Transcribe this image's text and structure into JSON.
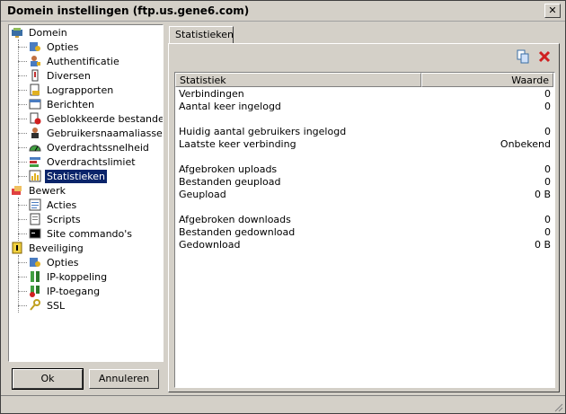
{
  "window": {
    "title": "Domein instellingen (ftp.us.gene6.com)",
    "close_glyph": "✕"
  },
  "tree": {
    "groups": [
      {
        "label": "Domein",
        "icon": "domain-icon"
      },
      {
        "label": "Bewerk",
        "icon": "edit-icon"
      },
      {
        "label": "Beveiliging",
        "icon": "security-icon"
      }
    ],
    "items": [
      {
        "label": "Opties",
        "icon": "options-icon"
      },
      {
        "label": "Authentificatie",
        "icon": "authentication-icon"
      },
      {
        "label": "Diversen",
        "icon": "misc-icon"
      },
      {
        "label": "Lograpporten",
        "icon": "logs-icon"
      },
      {
        "label": "Berichten",
        "icon": "messages-icon"
      },
      {
        "label": "Geblokkeerde bestanden",
        "icon": "blocked-files-icon"
      },
      {
        "label": "Gebruikersnaamaliassen",
        "icon": "user-aliases-icon"
      },
      {
        "label": "Overdrachtssnelheid",
        "icon": "speed-gauge-icon"
      },
      {
        "label": "Overdrachtslimiet",
        "icon": "transfer-limit-icon"
      },
      {
        "label": "Statistieken",
        "icon": "statistics-icon"
      },
      {
        "label": "Acties",
        "icon": "actions-icon"
      },
      {
        "label": "Scripts",
        "icon": "scripts-icon"
      },
      {
        "label": "Site commando's",
        "icon": "console-icon"
      },
      {
        "label": "Opties",
        "icon": "options-icon"
      },
      {
        "label": "IP-koppeling",
        "icon": "ip-binding-icon"
      },
      {
        "label": "IP-toegang",
        "icon": "ip-access-icon"
      },
      {
        "label": "SSL",
        "icon": "key-icon"
      }
    ],
    "selected": "Statistieken"
  },
  "buttons": {
    "ok": "Ok",
    "cancel": "Annuleren"
  },
  "tab": {
    "label": "Statistieken"
  },
  "toolbar": {
    "copy_icon": "copy-icon",
    "delete_icon": "delete-icon"
  },
  "table": {
    "headers": {
      "name": "Statistiek",
      "value": "Waarde"
    },
    "rows": [
      {
        "name": "Verbindingen",
        "value": "0"
      },
      {
        "name": "Aantal keer ingelogd",
        "value": "0"
      },
      {
        "name": "Huidig aantal gebruikers ingelogd",
        "value": "0"
      },
      {
        "name": "Laatste keer verbinding",
        "value": "Onbekend"
      },
      {
        "name": "Afgebroken uploads",
        "value": "0"
      },
      {
        "name": "Bestanden geupload",
        "value": "0"
      },
      {
        "name": "Geupload",
        "value": "0 B"
      },
      {
        "name": "Afgebroken downloads",
        "value": "0"
      },
      {
        "name": "Bestanden gedownload",
        "value": "0"
      },
      {
        "name": "Gedownload",
        "value": "0 B"
      }
    ]
  }
}
